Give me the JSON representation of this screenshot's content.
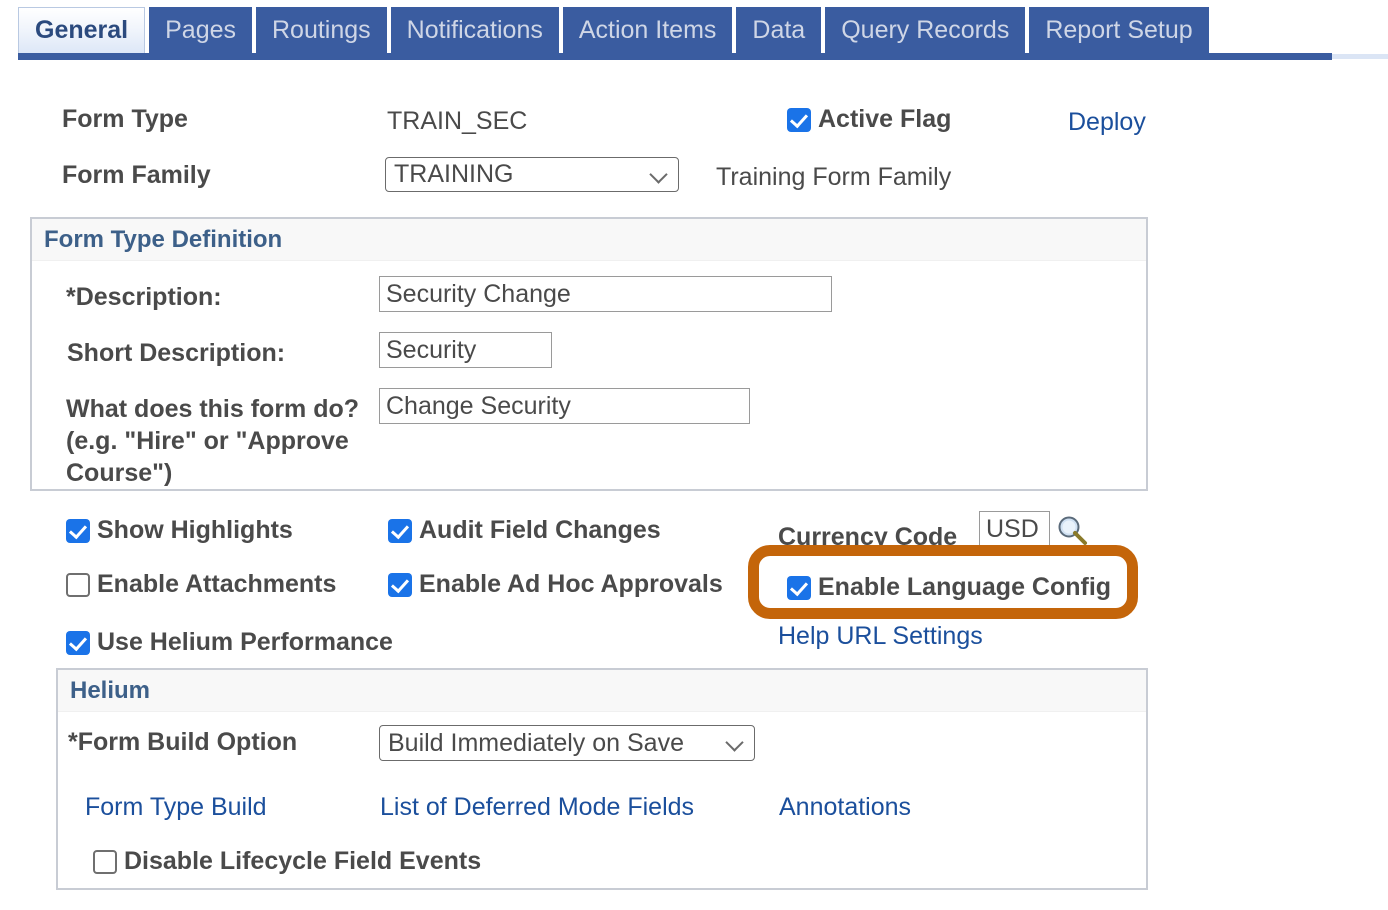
{
  "tabs": [
    {
      "label": "General",
      "active": true
    },
    {
      "label": "Pages",
      "active": false
    },
    {
      "label": "Routings",
      "active": false
    },
    {
      "label": "Notifications",
      "active": false
    },
    {
      "label": "Action Items",
      "active": false
    },
    {
      "label": "Data",
      "active": false
    },
    {
      "label": "Query Records",
      "active": false
    },
    {
      "label": "Report Setup",
      "active": false
    }
  ],
  "header": {
    "form_type_label": "Form Type",
    "form_type_value": "TRAIN_SEC",
    "form_family_label": "Form Family",
    "form_family_value": "TRAINING",
    "form_family_options": [
      "TRAINING"
    ],
    "form_family_description": "Training Form Family",
    "active_flag_label": "Active Flag",
    "active_flag_checked": true,
    "deploy_link": "Deploy"
  },
  "form_type_definition": {
    "title": "Form Type Definition",
    "description_label": "*Description:",
    "description_value": "Security Change",
    "short_description_label": "Short Description:",
    "short_description_value": "Security",
    "what_does_form_do_label": "What does this form do? (e.g. \"Hire\" or \"Approve Course\")",
    "what_does_form_do_line1": "What does this form do?",
    "what_does_form_do_line2": "(e.g. \"Hire\" or \"Approve",
    "what_does_form_do_line3": "Course\")",
    "what_does_form_do_value": "Change Security"
  },
  "options": {
    "show_highlights_label": "Show Highlights",
    "show_highlights_checked": true,
    "audit_field_changes_label": "Audit Field Changes",
    "audit_field_changes_checked": true,
    "enable_attachments_label": "Enable Attachments",
    "enable_attachments_checked": false,
    "enable_ad_hoc_approvals_label": "Enable Ad Hoc Approvals",
    "enable_ad_hoc_approvals_checked": true,
    "use_helium_performance_label": "Use Helium Performance",
    "use_helium_performance_checked": true,
    "enable_language_config_label": "Enable Language Config",
    "enable_language_config_checked": true,
    "currency_code_label": "Currency Code",
    "currency_code_value": "USD",
    "currency_lookup_icon": "magnifier-icon",
    "help_url_settings_link": "Help URL Settings"
  },
  "helium": {
    "title": "Helium",
    "form_build_option_label": "*Form Build Option",
    "form_build_option_value": "Build Immediately on Save",
    "form_build_option_options": [
      "Build Immediately on Save"
    ],
    "links": [
      "Form Type Build",
      "List of Deferred Mode Fields",
      "Annotations"
    ],
    "disable_lifecycle_label": "Disable Lifecycle Field Events",
    "disable_lifecycle_checked": false
  },
  "annotation": {
    "highlight_target": "Enable Language Config",
    "highlight_color": "#c4650a"
  },
  "colors": {
    "tab_active_text": "#2b4a7e",
    "tab_inactive_bg": "#3a5ca0",
    "tab_inactive_text": "#cfd6e6",
    "link": "#1b4f9c",
    "checkbox_on": "#1a73e8",
    "section_title": "#3d6089",
    "text": "#4a4a4a",
    "highlight": "#c4650a"
  }
}
